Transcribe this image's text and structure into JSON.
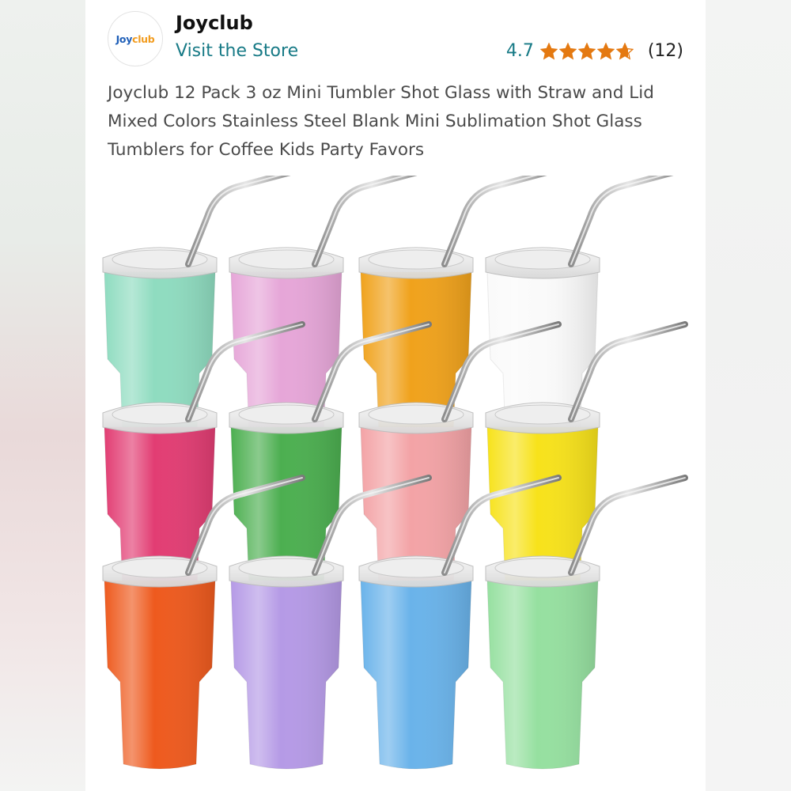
{
  "store": {
    "logo_text_joy": "Joy",
    "logo_text_club": "club",
    "name": "Joyclub",
    "visit_label": "Visit the Store"
  },
  "rating": {
    "value": "4.7",
    "stars": 4.7,
    "count": "(12)",
    "star_color": "#e47911"
  },
  "product": {
    "title": "Joyclub 12 Pack 3 oz Mini Tumbler Shot Glass with Straw and Lid Mixed Colors Stainless Steel Blank Mini Sublimation Shot Glass Tumblers for Coffee Kids Party Favors",
    "tumbler_colors": [
      [
        "#8fdcc0",
        "#e6a6d8",
        "#f0a21c",
        "#fafafa"
      ],
      [
        "#e23d73",
        "#4caf50",
        "#f3a3a6",
        "#f7e21b"
      ],
      [
        "#ee5a1e",
        "#b59ae6",
        "#6ab3ea",
        "#96e0a0"
      ]
    ]
  }
}
